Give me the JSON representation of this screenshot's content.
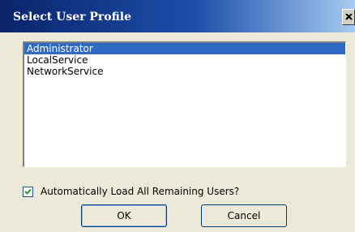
{
  "window": {
    "title": "Select User Profile",
    "close_icon": "close-icon"
  },
  "users": {
    "items": [
      {
        "label": "Administrator",
        "selected": true
      },
      {
        "label": "LocalService",
        "selected": false
      },
      {
        "label": "NetworkService",
        "selected": false
      }
    ]
  },
  "options": {
    "auto_load_label": "Automatically Load All Remaining Users?",
    "auto_load_checked": true
  },
  "buttons": {
    "ok_label": "OK",
    "cancel_label": "Cancel"
  },
  "colors": {
    "selection": "#316ac5",
    "titlebar": "#0a246a"
  }
}
